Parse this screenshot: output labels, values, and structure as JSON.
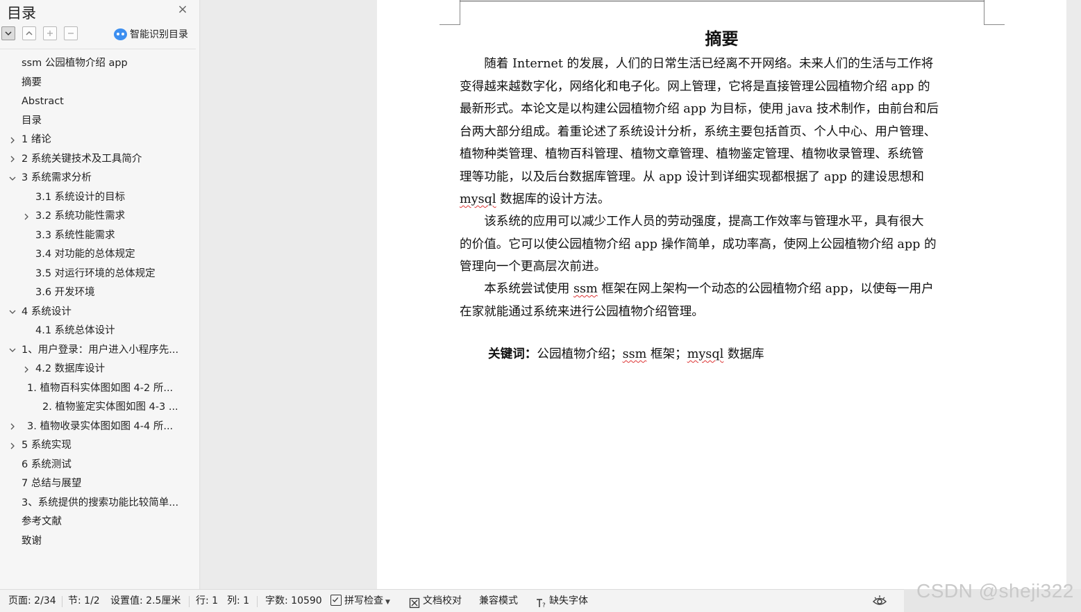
{
  "sidebar": {
    "title": "目录",
    "smart_toc_label": "智能识别目录",
    "toc": [
      {
        "label": "ssm 公园植物介绍 app",
        "indent": 0,
        "expander": "none"
      },
      {
        "label": "摘要",
        "indent": 0,
        "expander": "none"
      },
      {
        "label": "Abstract",
        "indent": 0,
        "expander": "none"
      },
      {
        "label": "目录",
        "indent": 0,
        "expander": "none"
      },
      {
        "label": "1  绪论",
        "indent": 0,
        "expander": "collapsed"
      },
      {
        "label": "2 系统关键技术及工具简介",
        "indent": 0,
        "expander": "collapsed"
      },
      {
        "label": "3 系统需求分析",
        "indent": 0,
        "expander": "expanded"
      },
      {
        "label": "3.1 系统设计的目标",
        "indent": 1,
        "expander": "none"
      },
      {
        "label": "3.2 系统功能性需求",
        "indent": 1,
        "expander": "collapsed"
      },
      {
        "label": "3.3 系统性能需求",
        "indent": 1,
        "expander": "none"
      },
      {
        "label": "3.4 对功能的总体规定",
        "indent": 1,
        "expander": "none"
      },
      {
        "label": "3.5 对运行环境的总体规定",
        "indent": 1,
        "expander": "none"
      },
      {
        "label": "3.6 开发环境",
        "indent": 1,
        "expander": "none"
      },
      {
        "label": "4 系统设计",
        "indent": 0,
        "expander": "expanded"
      },
      {
        "label": "4.1 系统总体设计",
        "indent": 1,
        "expander": "none"
      },
      {
        "label": "1、用户登录：用户进入小程序先...",
        "indent": 0,
        "expander": "expanded"
      },
      {
        "label": "4.2 数据库设计",
        "indent": 1,
        "expander": "collapsed"
      },
      {
        "label": "1.  植物百科实体图如图 4-2 所...",
        "indent": 2,
        "expander": "none"
      },
      {
        "label": "2.  植物鉴定实体图如图 4-3 ...",
        "indent": 3,
        "expander": "none"
      },
      {
        "label": "3.  植物收录实体图如图 4-4 所...",
        "indent": 2,
        "expander": "collapsed-left"
      },
      {
        "label": "5 系统实现",
        "indent": 0,
        "expander": "collapsed"
      },
      {
        "label": "6 系统测试",
        "indent": 0,
        "expander": "none"
      },
      {
        "label": "7 总结与展望",
        "indent": 0,
        "expander": "none"
      },
      {
        "label": "3、系统提供的搜索功能比较简单...",
        "indent": 0,
        "expander": "none"
      },
      {
        "label": "参考文献",
        "indent": 0,
        "expander": "none"
      },
      {
        "label": "致谢",
        "indent": 0,
        "expander": "none"
      }
    ]
  },
  "document": {
    "title": "摘要",
    "p1_lines": [
      "随着 Internet 的发展，人们的日常生活已经离不开网络。未来人们的生活与工作将",
      "变得越来越数字化，网络化和电子化。网上管理，它将是直接管理公园植物介绍 app 的",
      "最新形式。本论文是以构建公园植物介绍 app 为目标，使用 java 技术制作，由前台和后",
      "台两大部分组成。着重论述了系统设计分析，系统主要包括首页、个人中心、用户管理、",
      "植物种类管理、植物百科管理、植物文章管理、植物鉴定管理、植物收录管理、系统管",
      "理等功能，以及后台数据库管理。从 app 设计到详细实现都根据了 app 的建设思想和"
    ],
    "p1_last_word": "mysql",
    "p1_last_rest": " 数据库的设计方法。",
    "p2_lines": [
      "该系统的应用可以减少工作人员的劳动强度，提高工作效率与管理水平，具有很大",
      "的价值。它可以使公园植物介绍 app 操作简单，成功率高，使网上公园植物介绍 app 的",
      "管理向一个更高层次前进。"
    ],
    "p3_pre": "本系统尝试使用 ",
    "p3_ssm": "ssm",
    "p3_rest": " 框架在网上架构一个动态的公园植物介绍 app，以使每一用户",
    "p3_line2": "在家就能通过系统来进行公园植物介绍管理。",
    "kw_label": "关键词：",
    "kw_a": "公园植物介绍；",
    "kw_ssm": "ssm",
    "kw_b": " 框架；",
    "kw_mysql": "mysql",
    "kw_c": " 数据库"
  },
  "status": {
    "page": "页面: 2/34",
    "section": "节: 1/2",
    "setting": "设置值: 2.5厘米",
    "row": "行: 1",
    "col": "列: 1",
    "words": "字数: 10590",
    "spell": "拼写检查",
    "proof": "文档校对",
    "compat": "兼容模式",
    "missing_font": "缺失字体"
  },
  "watermark": "CSDN @sheji322"
}
